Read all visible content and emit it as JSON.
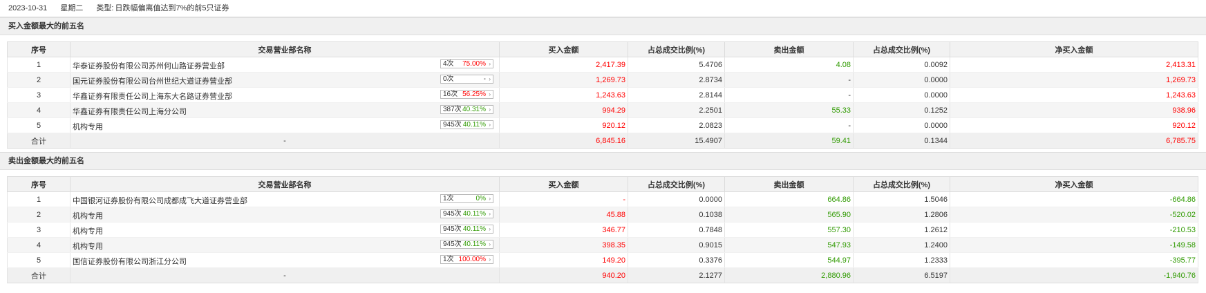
{
  "info": {
    "date": "2023-10-31",
    "weekday": "星期二",
    "type_label": "类型:",
    "type_value": "日跌幅偏离值达到7%的前5只证券"
  },
  "buy_section": {
    "title": "买入金额最大的前五名",
    "headers": [
      "序号",
      "交易营业部名称",
      "买入金额",
      "占总成交比例(%)",
      "卖出金额",
      "占总成交比例(%)",
      "净买入金额"
    ],
    "rows": [
      {
        "idx": "1",
        "name": "华泰证券股份有限公司苏州何山路证券营业部",
        "count": "4次",
        "rate": "75.00%",
        "rate_color": "red",
        "buy": "2,417.39",
        "buy_pct": "5.4706",
        "sell": "4.08",
        "sell_pct": "0.0092",
        "net": "2,413.31",
        "net_color": "red"
      },
      {
        "idx": "2",
        "name": "国元证券股份有限公司台州世纪大道证券营业部",
        "count": "0次",
        "rate": "-",
        "rate_color": "blk",
        "buy": "1,269.73",
        "buy_pct": "2.8734",
        "sell": "-",
        "sell_pct": "0.0000",
        "net": "1,269.73",
        "net_color": "red"
      },
      {
        "idx": "3",
        "name": "华鑫证券有限责任公司上海东大名路证券营业部",
        "count": "16次",
        "rate": "56.25%",
        "rate_color": "red",
        "buy": "1,243.63",
        "buy_pct": "2.8144",
        "sell": "-",
        "sell_pct": "0.0000",
        "net": "1,243.63",
        "net_color": "red"
      },
      {
        "idx": "4",
        "name": "华鑫证券有限责任公司上海分公司",
        "count": "387次",
        "rate": "40.31%",
        "rate_color": "green",
        "buy": "994.29",
        "buy_pct": "2.2501",
        "sell": "55.33",
        "sell_pct": "0.1252",
        "net": "938.96",
        "net_color": "red"
      },
      {
        "idx": "5",
        "name": "机构专用",
        "count": "945次",
        "rate": "40.11%",
        "rate_color": "green",
        "buy": "920.12",
        "buy_pct": "2.0823",
        "sell": "-",
        "sell_pct": "0.0000",
        "net": "920.12",
        "net_color": "red"
      }
    ],
    "total": {
      "label": "合计",
      "name": "-",
      "buy": "6,845.16",
      "buy_pct": "15.4907",
      "sell": "59.41",
      "sell_pct": "0.1344",
      "net": "6,785.75",
      "net_color": "red"
    }
  },
  "sell_section": {
    "title": "卖出金额最大的前五名",
    "headers": [
      "序号",
      "交易营业部名称",
      "买入金额",
      "占总成交比例(%)",
      "卖出金额",
      "占总成交比例(%)",
      "净买入金额"
    ],
    "rows": [
      {
        "idx": "1",
        "name": "中国银河证券股份有限公司成都成飞大道证券营业部",
        "count": "1次",
        "rate": "0%",
        "rate_color": "green",
        "buy": "-",
        "buy_pct": "0.0000",
        "sell": "664.86",
        "sell_pct": "1.5046",
        "net": "-664.86",
        "net_color": "green"
      },
      {
        "idx": "2",
        "name": "机构专用",
        "count": "945次",
        "rate": "40.11%",
        "rate_color": "green",
        "buy": "45.88",
        "buy_pct": "0.1038",
        "sell": "565.90",
        "sell_pct": "1.2806",
        "net": "-520.02",
        "net_color": "green"
      },
      {
        "idx": "3",
        "name": "机构专用",
        "count": "945次",
        "rate": "40.11%",
        "rate_color": "green",
        "buy": "346.77",
        "buy_pct": "0.7848",
        "sell": "557.30",
        "sell_pct": "1.2612",
        "net": "-210.53",
        "net_color": "green"
      },
      {
        "idx": "4",
        "name": "机构专用",
        "count": "945次",
        "rate": "40.11%",
        "rate_color": "green",
        "buy": "398.35",
        "buy_pct": "0.9015",
        "sell": "547.93",
        "sell_pct": "1.2400",
        "net": "-149.58",
        "net_color": "green"
      },
      {
        "idx": "5",
        "name": "国信证券股份有限公司浙江分公司",
        "count": "1次",
        "rate": "100.00%",
        "rate_color": "red",
        "buy": "149.20",
        "buy_pct": "0.3376",
        "sell": "544.97",
        "sell_pct": "1.2333",
        "net": "-395.77",
        "net_color": "green"
      }
    ],
    "total": {
      "label": "合计",
      "name": "-",
      "buy": "940.20",
      "buy_pct": "2.1277",
      "sell": "2,880.96",
      "sell_pct": "6.5197",
      "net": "-1,940.76",
      "net_color": "green"
    }
  },
  "colors": {
    "positive": "#ff0000",
    "negative": "#2f9a00",
    "header_bg": "#f2f2f2",
    "section_bg": "#f0f0f0"
  },
  "icons": {
    "pill_arrow": "chevron-right-icon"
  }
}
